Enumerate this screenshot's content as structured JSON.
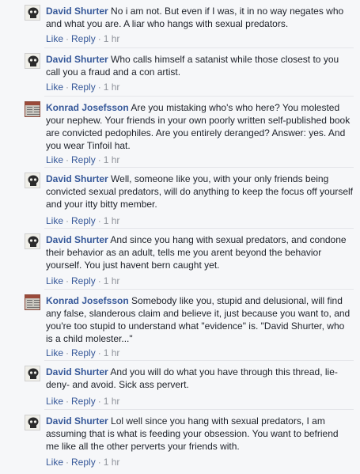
{
  "comments": [
    {
      "author": "David Shurter",
      "avatar": "skull-icon",
      "text": "No i am not. But even if I was, it in no way negates who and what you are. A liar who hangs with sexual predators.",
      "like": "Like",
      "reply": "Reply",
      "sep": "·",
      "time": "1 hr"
    },
    {
      "author": "David Shurter",
      "avatar": "skull-icon",
      "text": "Who calls himself a satanist while those closest to you call you a fraud and a con artist.",
      "like": "Like",
      "reply": "Reply",
      "sep": "·",
      "time": "1 hr"
    },
    {
      "author": "Konrad Josefsson",
      "avatar": "book-icon",
      "text": "Are you mistaking who's who here? You molested your nephew. Your friends in your own poorly written self-published book are convicted pedophiles. Are you entirely deranged? Answer: yes. And you wear Tinfoil hat.",
      "like": "Like",
      "reply": "Reply",
      "sep": "·",
      "time": "1 hr"
    },
    {
      "author": "David Shurter",
      "avatar": "skull-icon",
      "text": "Well, someone like you, with your only friends being convicted sexual predators, will do anything to keep the focus off yourself and your itty bitty member.",
      "like": "Like",
      "reply": "Reply",
      "sep": "·",
      "time": "1 hr"
    },
    {
      "author": "David Shurter",
      "avatar": "skull-icon",
      "text": "And since you hang with sexual predators, and condone their behavior as an adult, tells me you arent beyond the behavior yourself. You just havent bern caught yet.",
      "like": "Like",
      "reply": "Reply",
      "sep": "·",
      "time": "1 hr"
    },
    {
      "author": "Konrad Josefsson",
      "avatar": "book-icon",
      "text": "Somebody like you, stupid and delusional, will find any false, slanderous claim and believe it, just because you want to, and you're too stupid to understand what \"evidence\" is. \"David Shurter, who is a child molester...\"",
      "like": "Like",
      "reply": "Reply",
      "sep": "·",
      "time": "1 hr"
    },
    {
      "author": "David Shurter",
      "avatar": "skull-icon",
      "text": "And you will do what you have through this thread, lie-deny- and avoid. Sick ass pervert.",
      "like": "Like",
      "reply": "Reply",
      "sep": "·",
      "time": "1 hr"
    },
    {
      "author": "David Shurter",
      "avatar": "skull-icon",
      "text": "Lol well since you hang with sexual predators, I am assuming that is what is feeding your obsession. You want to befriend me like all the other perverts your friends with.",
      "like": "Like",
      "reply": "Reply",
      "sep": "·",
      "time": "1 hr"
    }
  ]
}
